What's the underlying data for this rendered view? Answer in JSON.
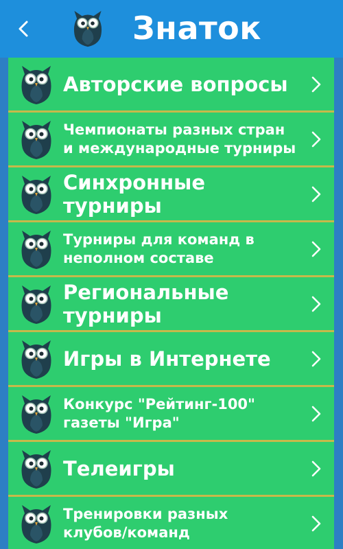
{
  "app_bar": {
    "title": "Знаток",
    "back_icon": "chevron-left-icon",
    "logo_icon": "owl-logo-icon",
    "background": "#1e8fdc"
  },
  "colors": {
    "page_background": "#2d7fc4",
    "row_background": "#2ecd6f",
    "row_divider": "#c7b94a",
    "text": "#ffffff"
  },
  "categories": [
    {
      "label": "Авторские вопросы",
      "size": "big",
      "icon": "owl-icon"
    },
    {
      "label": "Чемпионаты разных стран\nи международные турниры",
      "size": "small",
      "icon": "owl-icon"
    },
    {
      "label": "Синхронные турниры",
      "size": "big",
      "icon": "owl-icon"
    },
    {
      "label": "Турниры для команд в\nнеполном составе",
      "size": "small",
      "icon": "owl-icon"
    },
    {
      "label": "Региональные турниры",
      "size": "big",
      "icon": "owl-icon"
    },
    {
      "label": "Игры в Интернете",
      "size": "big",
      "icon": "owl-icon"
    },
    {
      "label": "Конкурс \"Рейтинг-100\"\nгазеты \"Игра\"",
      "size": "small",
      "icon": "owl-icon"
    },
    {
      "label": "Телеигры",
      "size": "big",
      "icon": "owl-icon"
    },
    {
      "label": "Тренировки разных\nклубов/команд",
      "size": "small",
      "icon": "owl-icon"
    }
  ]
}
